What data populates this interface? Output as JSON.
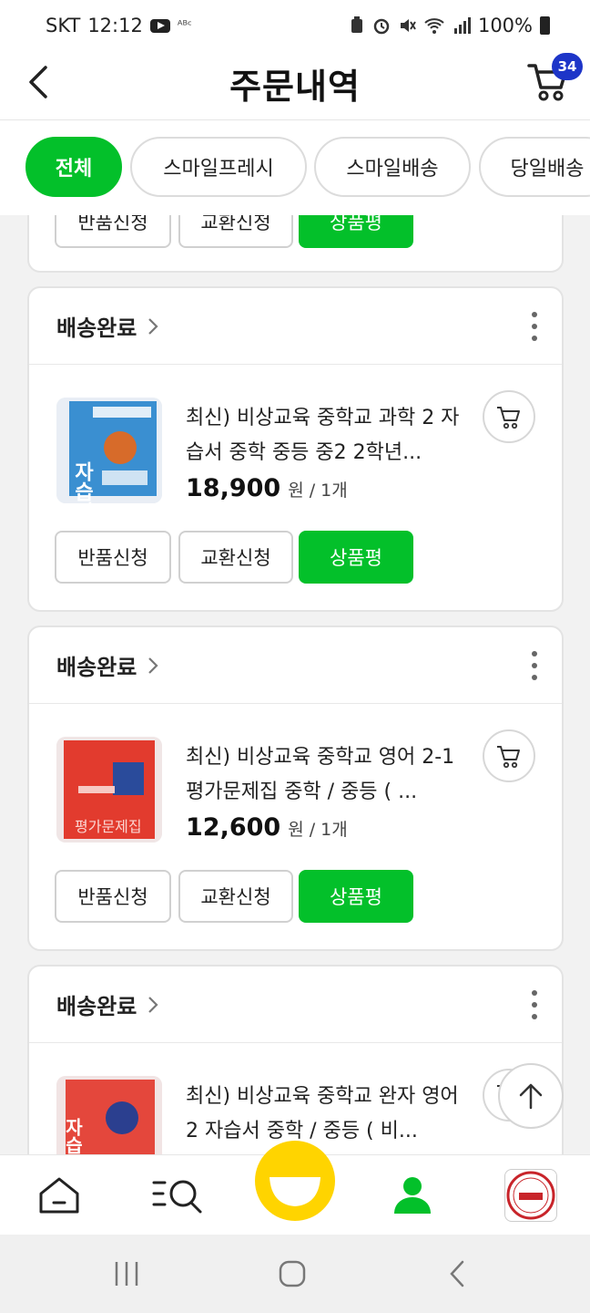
{
  "status_bar": {
    "carrier": "SKT",
    "time": "12:12",
    "extra_icon_text": "ᴬᴮᶜ",
    "battery": "100%"
  },
  "header": {
    "title": "주문내역",
    "cart_count": "34"
  },
  "filters": [
    {
      "label": "전체"
    },
    {
      "label": "스마일프레시"
    },
    {
      "label": "스마일배송"
    },
    {
      "label": "당일배송"
    }
  ],
  "partial_card": {
    "buttons": {
      "return": "반품신청",
      "exchange": "교환신청",
      "review": "상품평"
    }
  },
  "orders": [
    {
      "status": "배송완료",
      "title": "최신) 비상교육 중학교 과학 2 자습서 중학 중등 중2 2학년...",
      "price": "18,900",
      "unit": "원 / 1개",
      "thumb_text": "자습서",
      "buttons": {
        "return": "반품신청",
        "exchange": "교환신청",
        "review": "상품평"
      }
    },
    {
      "status": "배송완료",
      "title": "최신) 비상교육 중학교 영어 2-1 평가문제집 중학 / 중등 ( ...",
      "price": "12,600",
      "unit": "원 / 1개",
      "thumb_text": "평가문제집",
      "buttons": {
        "return": "반품신청",
        "exchange": "교환신청",
        "review": "상품평"
      }
    },
    {
      "status": "배송완료",
      "title": "최신) 비상교육 중학교 완자 영어 2 자습서 중학 / 중등 ( 비...",
      "thumb_text": "자습서",
      "buttons": {}
    }
  ],
  "colors": {
    "accent_green": "#03c02a",
    "badge_blue": "#1d35c8",
    "smile_yellow": "#ffd400"
  },
  "icons": [
    "back-icon",
    "cart-icon",
    "chevron-right-icon",
    "more-vertical-icon",
    "add-to-cart-icon",
    "arrow-up-icon",
    "home-icon",
    "search-menu-icon",
    "smile-icon",
    "user-icon",
    "recent-item-thumbnail"
  ]
}
